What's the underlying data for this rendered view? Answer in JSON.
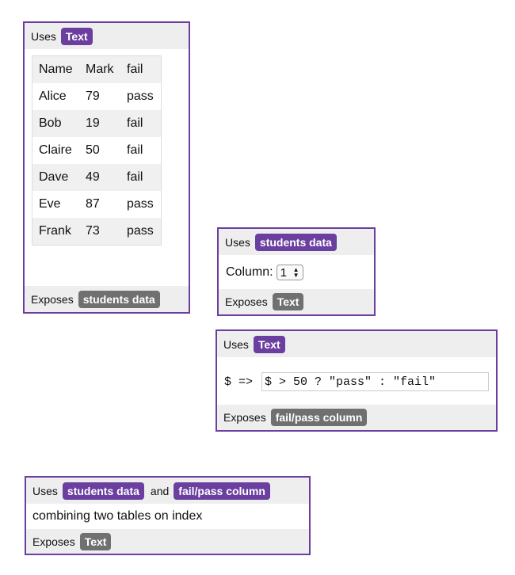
{
  "node1": {
    "uses_label": "Uses",
    "uses_tag": "Text",
    "table": {
      "headers": [
        "Name",
        "Mark",
        "fail"
      ],
      "rows": [
        [
          "Alice",
          "79",
          "pass"
        ],
        [
          "Bob",
          "19",
          "fail"
        ],
        [
          "Claire",
          "50",
          "fail"
        ],
        [
          "Dave",
          "49",
          "fail"
        ],
        [
          "Eve",
          "87",
          "pass"
        ],
        [
          "Frank",
          "73",
          "pass"
        ]
      ]
    },
    "exposes_label": "Exposes",
    "exposes_tag": "students data"
  },
  "node2": {
    "uses_label": "Uses",
    "uses_tag": "students data",
    "column_label": "Column:",
    "column_value": "1",
    "exposes_label": "Exposes",
    "exposes_tag": "Text"
  },
  "node3": {
    "uses_label": "Uses",
    "uses_tag": "Text",
    "param_label": "$ =>",
    "expression": "$ > 50 ? \"pass\" : \"fail\"",
    "exposes_label": "Exposes",
    "exposes_tag": "fail/pass column"
  },
  "node4": {
    "uses_label": "Uses",
    "uses_tag_1": "students data",
    "and_text": "and",
    "uses_tag_2": "fail/pass column",
    "description": "combining two tables on index",
    "exposes_label": "Exposes",
    "exposes_tag": "Text"
  },
  "colors": {
    "border": "#6a3fa0",
    "tag_purple": "#6a3fa0",
    "tag_gray": "#707070",
    "bar_bg": "#eeeeee"
  }
}
